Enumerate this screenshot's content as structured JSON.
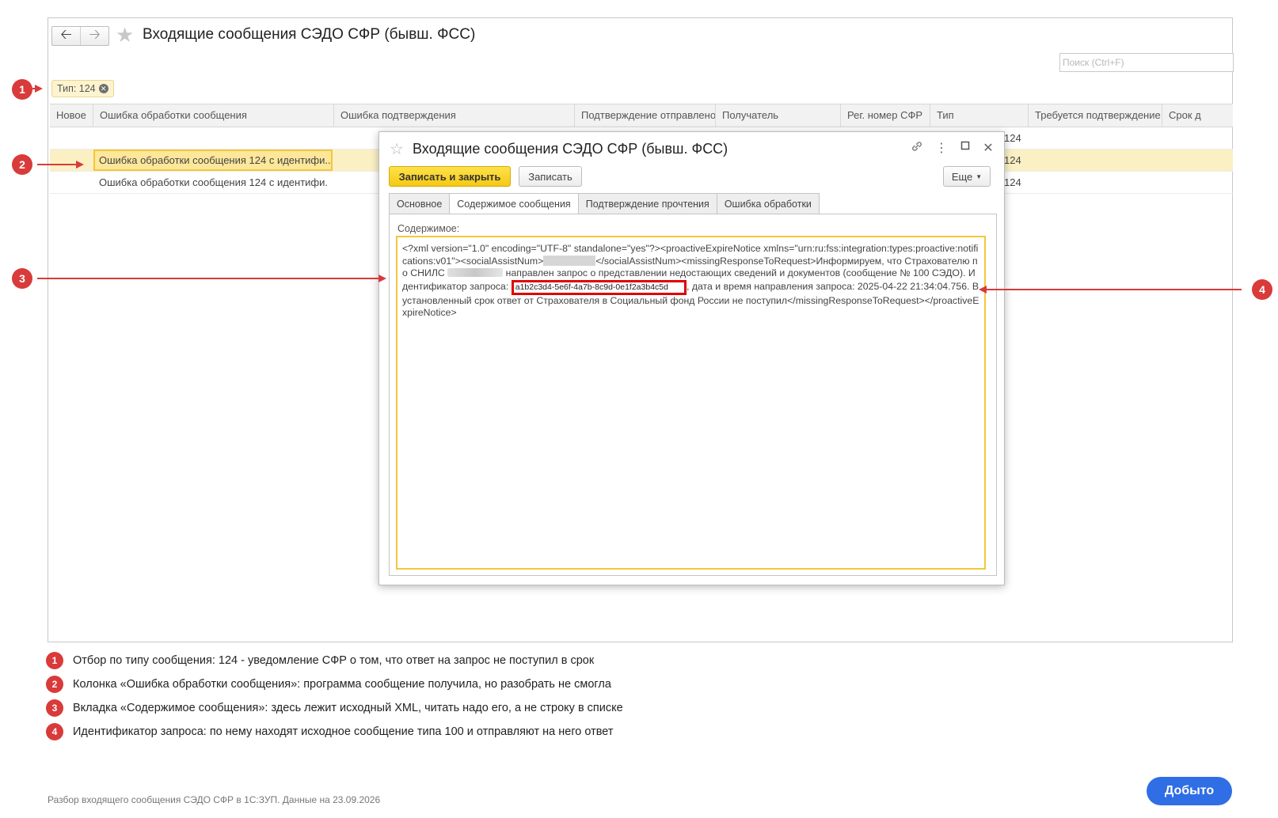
{
  "main_window": {
    "title": "Входящие сообщения СЭДО СФР (бывш. ФСС)",
    "search_placeholder": "Поиск (Ctrl+F)",
    "filter_label": "Тип: 124",
    "columns": [
      "Новое",
      "Ошибка обработки сообщения",
      "Ошибка подтверждения",
      "Подтверждение отправлено",
      "Получатель",
      "Рег. номер СФР",
      "Тип",
      "Требуется подтверждение",
      "Срок д"
    ],
    "rows": [
      {
        "error": "",
        "type": "124"
      },
      {
        "error": "Ошибка обработки сообщения 124 с идентифи...",
        "type": "124"
      },
      {
        "error": "Ошибка обработки сообщения 124 с идентифи...",
        "type": "124"
      }
    ]
  },
  "dialog": {
    "title": "Входящие сообщения СЭДО СФР (бывш. ФСС)",
    "save_close_label": "Записать и закрыть",
    "save_label": "Записать",
    "more_label": "Еще",
    "tabs": [
      "Основное",
      "Содержимое сообщения",
      "Подтверждение прочтения",
      "Ошибка обработки"
    ],
    "content_label": "Содержимое:",
    "content": {
      "part1": "<?xml version=\"1.0\" encoding=\"UTF-8\" standalone=\"yes\"?><proactiveExpireNotice xmlns=\"urn:ru:fss:integration:types:proactive:notifications:v01\"><socialAssistNum>",
      "part2": "</socialAssistNum><missingResponseToRequest>Информируем, что Страхователю по СНИЛС ",
      "part3": " направлен запрос о представлении недостающих сведений и документов (сообщение № 100 СЭДО). Идентификатор запроса: ",
      "request_id": "a1b2c3d4-5e6f-4a7b-8c9d-0e1f2a3b4c5d",
      "part4": ", дата и время направления запроса: 2025-04-22 21:34:04.756. В установленный срок ответ от Страхователя в Социальный фонд России не поступил</missingResponseToRequest></proactiveExpireNotice>"
    }
  },
  "annotations": {
    "badges": [
      "1",
      "2",
      "3",
      "4"
    ],
    "legend": [
      "Отбор по типу сообщения: 124 - уведомление СФР о том, что ответ на запрос не поступил в срок",
      "Колонка «Ошибка обработки сообщения»: программа сообщение получила, но разобрать не смогла",
      "Вкладка «Содержимое сообщения»: здесь лежит исходный XML, читать надо его, а не строку в списке",
      "Идентификатор запроса: по нему находят исходное сообщение типа 100 и отправляют на него ответ"
    ]
  },
  "footer": "Разбор входящего сообщения СЭДО СФР в 1С:ЗУП. Данные на 23.09.2026",
  "cta_label": "Добыто",
  "colors": {
    "accent_yellow": "#f5c814",
    "annotation_red": "#d93a3a",
    "cta_blue": "#2f6ee5"
  }
}
